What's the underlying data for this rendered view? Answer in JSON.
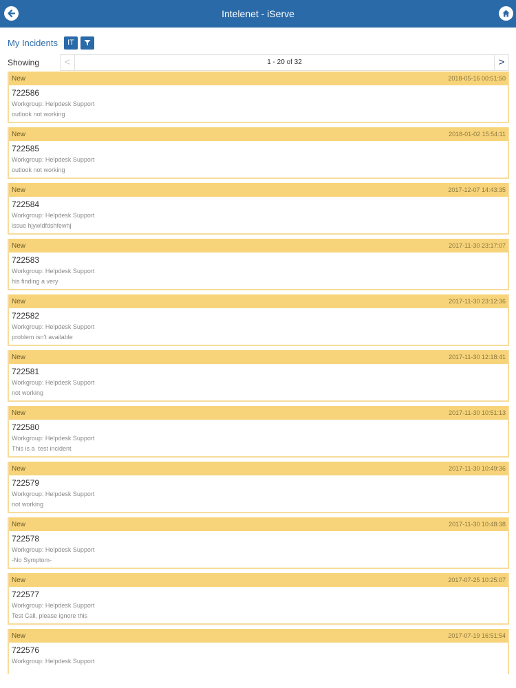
{
  "header": {
    "title": "Intelenet - iServe"
  },
  "subheader": {
    "label": "My Incidents",
    "it_button": "IT"
  },
  "pager": {
    "showing": "Showing",
    "range": "1 - 20 of 32"
  },
  "incidents": [
    {
      "status": "New",
      "timestamp": "2018-05-16 00:51:50",
      "number": "722586",
      "workgroup": "Workgroup: Helpdesk Support",
      "description": "outlook not working"
    },
    {
      "status": "New",
      "timestamp": "2018-01-02 15:54:11",
      "number": "722585",
      "workgroup": "Workgroup: Helpdesk Support",
      "description": "outlook not working"
    },
    {
      "status": "New",
      "timestamp": "2017-12-07 14:43:35",
      "number": "722584",
      "workgroup": "Workgroup: Helpdesk Support",
      "description": "issue hjywldfdshfewhj"
    },
    {
      "status": "New",
      "timestamp": "2017-11-30 23:17:07",
      "number": "722583",
      "workgroup": "Workgroup: Helpdesk Support",
      "description": "his finding a very"
    },
    {
      "status": "New",
      "timestamp": "2017-11-30 23:12:36",
      "number": "722582",
      "workgroup": "Workgroup: Helpdesk Support",
      "description": "problem isn't available"
    },
    {
      "status": "New",
      "timestamp": "2017-11-30 12:18:41",
      "number": "722581",
      "workgroup": "Workgroup: Helpdesk Support",
      "description": "not working"
    },
    {
      "status": "New",
      "timestamp": "2017-11-30 10:51:13",
      "number": "722580",
      "workgroup": "Workgroup: Helpdesk Support",
      "description": "This is a  test incident"
    },
    {
      "status": "New",
      "timestamp": "2017-11-30 10:49:36",
      "number": "722579",
      "workgroup": "Workgroup: Helpdesk Support",
      "description": "not working"
    },
    {
      "status": "New",
      "timestamp": "2017-11-30 10:48:38",
      "number": "722578",
      "workgroup": "Workgroup: Helpdesk Support",
      "description": "-No Symptom-"
    },
    {
      "status": "New",
      "timestamp": "2017-07-25 10:25:07",
      "number": "722577",
      "workgroup": "Workgroup: Helpdesk Support",
      "description": "Test Call, please ignore this"
    },
    {
      "status": "New",
      "timestamp": "2017-07-19 16:51:54",
      "number": "722576",
      "workgroup": "Workgroup: Helpdesk Support",
      "description": ""
    }
  ],
  "colors": {
    "brand_blue": "#2a6aa8",
    "card_header": "#f7d47a"
  },
  "icons": {
    "back": "back-arrow-icon",
    "home": "home-icon",
    "filter": "filter-icon",
    "prev": "chevron-left-icon",
    "next": "chevron-right-icon"
  }
}
